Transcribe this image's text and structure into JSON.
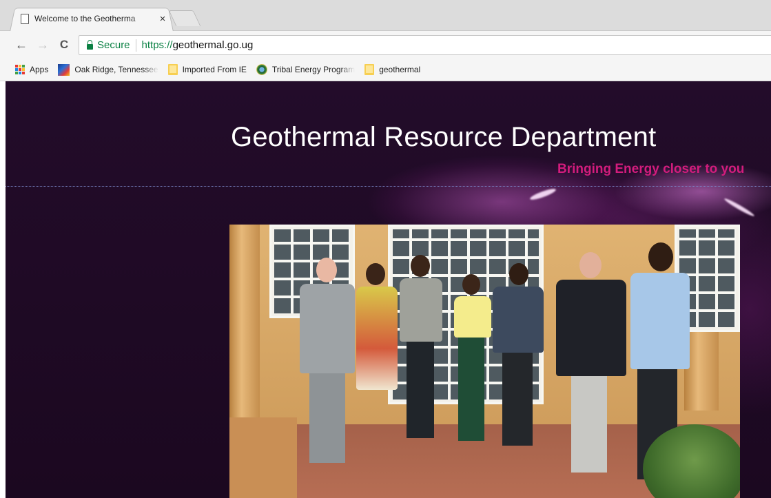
{
  "browser": {
    "tab_title": "Welcome to the Geotherma",
    "tab_close": "×",
    "nav": {
      "back": "←",
      "forward": "→",
      "reload": "C"
    },
    "address": {
      "secure_label": "Secure",
      "url_scheme": "https://",
      "url_host": "geothermal.go.ug"
    },
    "bookmarks": [
      {
        "label": "Apps",
        "icon": "apps-grid-icon"
      },
      {
        "label": "Oak Ridge, Tennessee",
        "icon": "site-favicon"
      },
      {
        "label": "Imported From IE",
        "icon": "folder-icon"
      },
      {
        "label": "Tribal Energy Program",
        "icon": "doe-seal-icon"
      },
      {
        "label": "geothermal",
        "icon": "folder-icon"
      }
    ]
  },
  "page": {
    "title": "Geothermal Resource Department",
    "tagline": "Bringing Energy closer to you"
  },
  "colors": {
    "background": "#1c0a22",
    "tagline": "#d31c7d",
    "secure_green": "#0a8043",
    "title": "#ffffff"
  }
}
